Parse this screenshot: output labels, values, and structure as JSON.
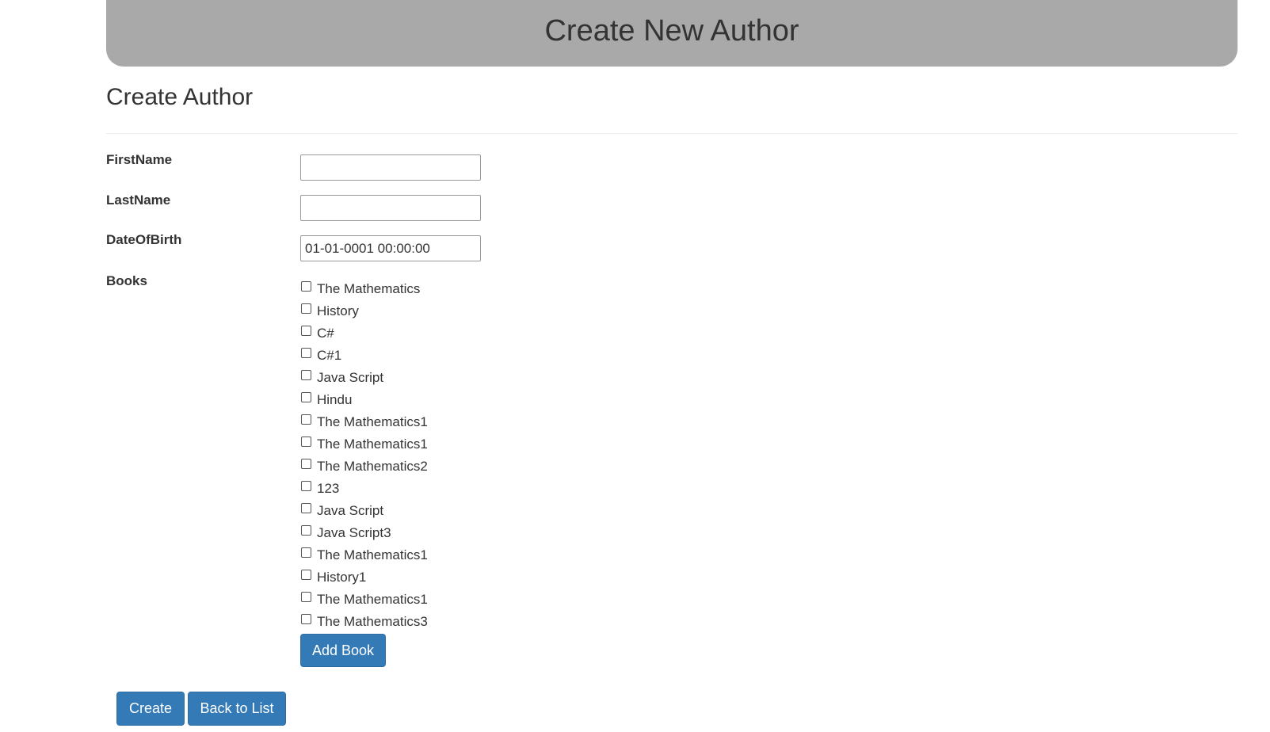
{
  "banner": {
    "title": "Create New Author"
  },
  "page": {
    "heading": "Create Author"
  },
  "form": {
    "first_name": {
      "label": "FirstName",
      "value": ""
    },
    "last_name": {
      "label": "LastName",
      "value": ""
    },
    "date_of_birth": {
      "label": "DateOfBirth",
      "value": "01-01-0001 00:00:00"
    },
    "books": {
      "label": "Books",
      "items": [
        {
          "label": "The Mathematics",
          "checked": false
        },
        {
          "label": "History",
          "checked": false
        },
        {
          "label": "C#",
          "checked": false
        },
        {
          "label": "C#1",
          "checked": false
        },
        {
          "label": "Java Script",
          "checked": false
        },
        {
          "label": "Hindu",
          "checked": false
        },
        {
          "label": "The Mathematics1",
          "checked": false
        },
        {
          "label": "The Mathematics1",
          "checked": false
        },
        {
          "label": "The Mathematics2",
          "checked": false
        },
        {
          "label": "123",
          "checked": false
        },
        {
          "label": "Java Script",
          "checked": false
        },
        {
          "label": "Java Script3",
          "checked": false
        },
        {
          "label": "The Mathematics1",
          "checked": false
        },
        {
          "label": "History1",
          "checked": false
        },
        {
          "label": "The Mathematics1",
          "checked": false
        },
        {
          "label": "The Mathematics3",
          "checked": false
        }
      ],
      "add_book_label": "Add Book"
    }
  },
  "actions": {
    "create_label": "Create",
    "back_label": "Back to List"
  },
  "colors": {
    "banner_bg": "#a9a9a9",
    "primary_button": "#337ab7",
    "text": "#333333"
  }
}
